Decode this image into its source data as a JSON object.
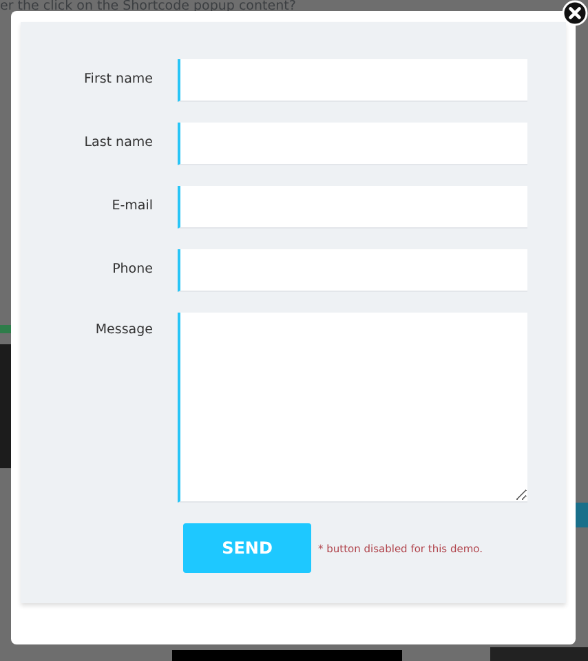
{
  "backdrop": {
    "text": "er the click on the Shortcode popup content?"
  },
  "form": {
    "fields": [
      {
        "label": "First name",
        "kind": "text"
      },
      {
        "label": "Last name",
        "kind": "text"
      },
      {
        "label": "E-mail",
        "kind": "text"
      },
      {
        "label": "Phone",
        "kind": "text"
      },
      {
        "label": "Message",
        "kind": "textarea"
      }
    ],
    "submit": {
      "label": "SEND"
    },
    "note": "* button disabled for this demo."
  }
}
